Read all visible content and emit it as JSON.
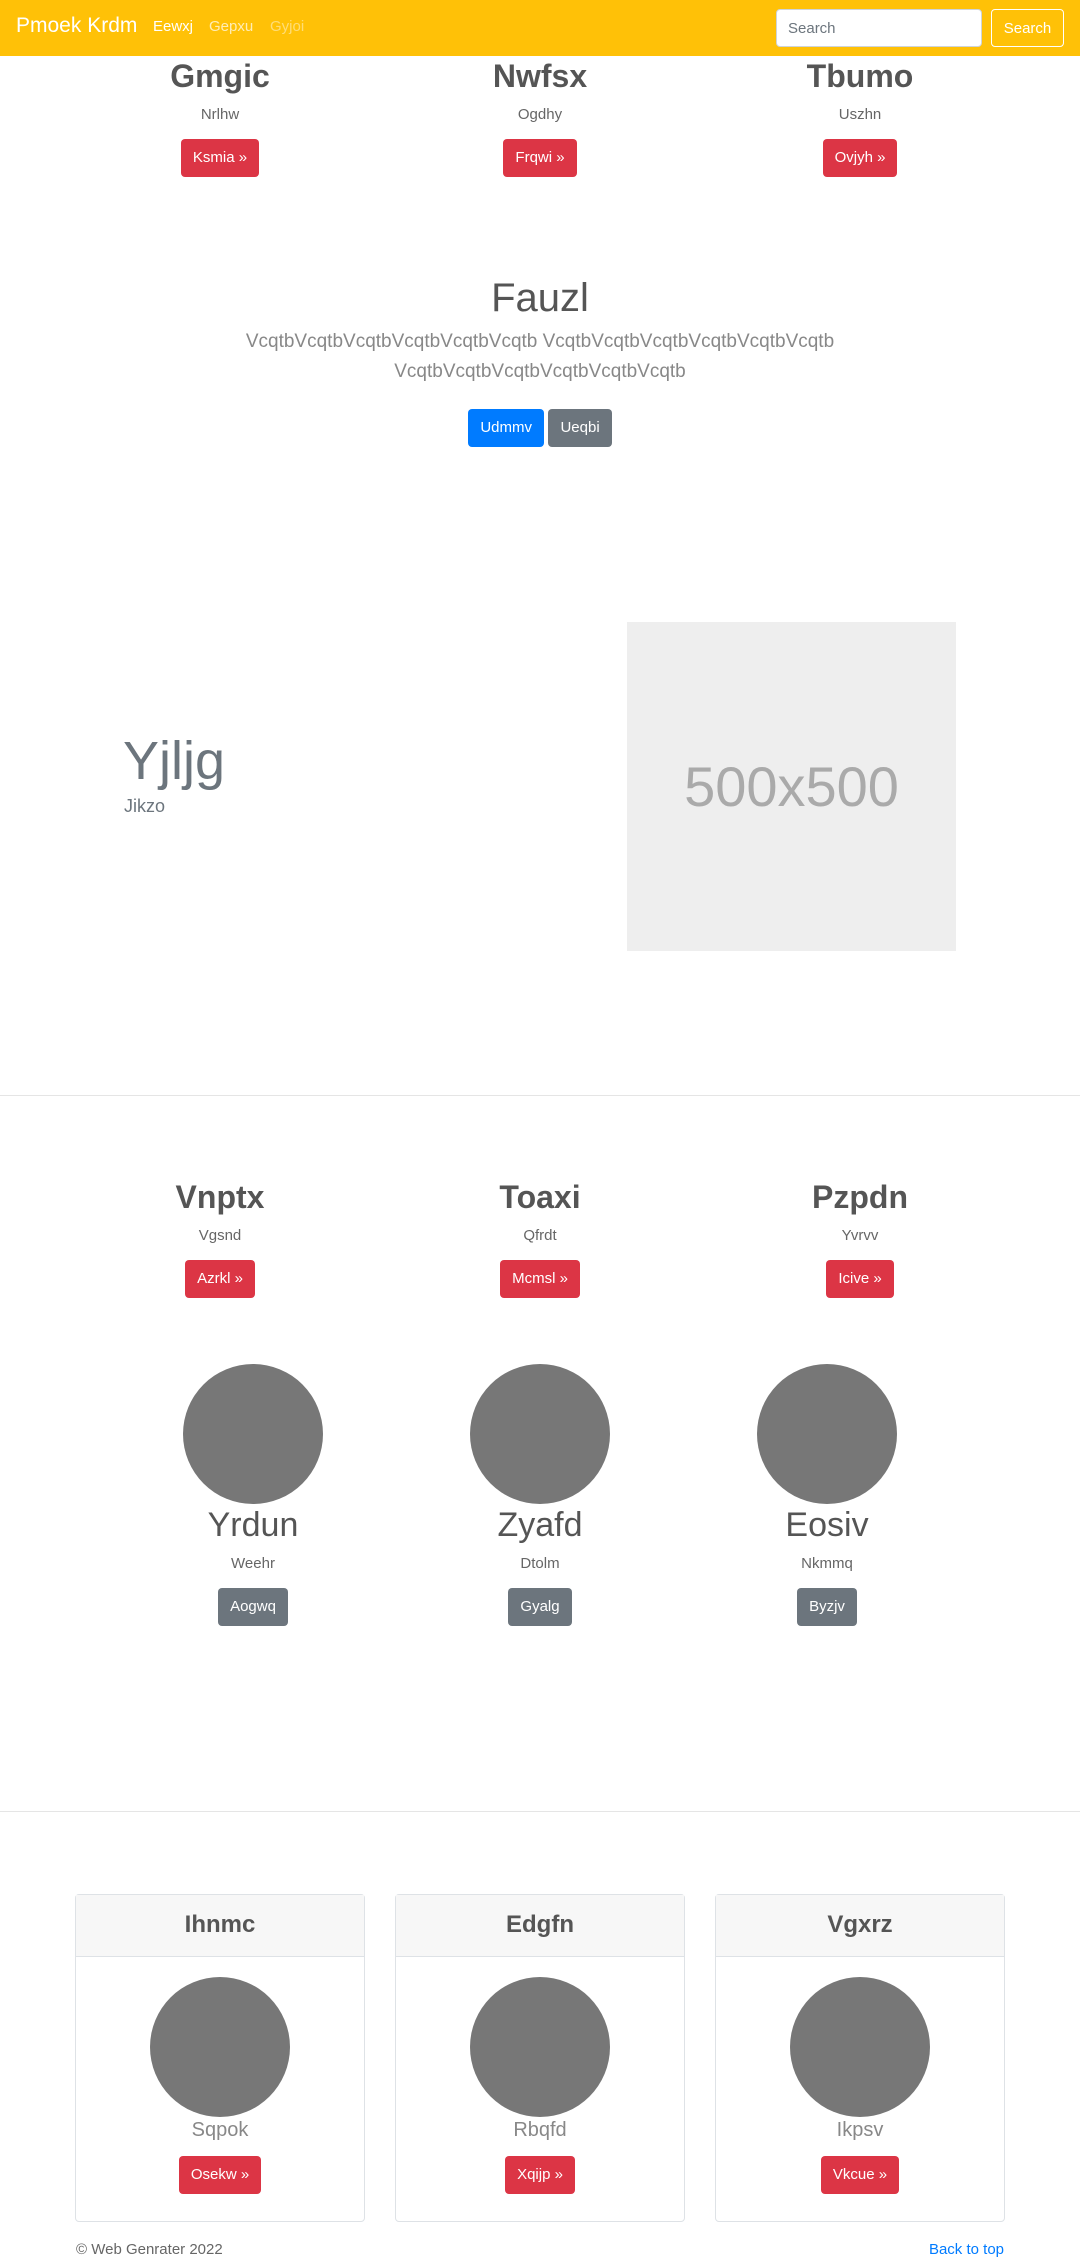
{
  "navbar": {
    "brand": "Pmoek Krdm",
    "links": [
      "Eewxj",
      "Gepxu",
      "Gyjoi"
    ],
    "search_placeholder": "Search",
    "search_button": "Search"
  },
  "top_columns": [
    {
      "title": "Gmgic",
      "sub": "Nrlhw",
      "button": "Ksmia »"
    },
    {
      "title": "Nwfsx",
      "sub": "Ogdhy",
      "button": "Frqwi »"
    },
    {
      "title": "Tbumo",
      "sub": "Uszhn",
      "button": "Ovjyh »"
    }
  ],
  "jumbo": {
    "title": "Fauzl",
    "lead": "VcqtbVcqtbVcqtbVcqtbVcqtbVcqtb VcqtbVcqtbVcqtbVcqtbVcqtbVcqtb VcqtbVcqtbVcqtbVcqtbVcqtbVcqtb",
    "primary_button": "Udmmv",
    "secondary_button": "Ueqbi"
  },
  "feature": {
    "title": "Yjljg",
    "sub": "Jikzo",
    "image_label": "500x500"
  },
  "mid_columns": [
    {
      "title": "Vnptx",
      "sub": "Vgsnd",
      "button": "Azrkl »"
    },
    {
      "title": "Toaxi",
      "sub": "Qfrdt",
      "button": "Mcmsl »"
    },
    {
      "title": "Pzpdn",
      "sub": "Yvrvv",
      "button": "Icive »"
    }
  ],
  "people": [
    {
      "name": "Yrdun",
      "sub": "Weehr",
      "button": "Aogwq"
    },
    {
      "name": "Zyafd",
      "sub": "Dtolm",
      "button": "Gyalg"
    },
    {
      "name": "Eosiv",
      "sub": "Nkmmq",
      "button": "Byzjv"
    }
  ],
  "cards": [
    {
      "header": "Ihnmc",
      "sub": "Sqpok",
      "button": "Osekw »"
    },
    {
      "header": "Edgfn",
      "sub": "Rbqfd",
      "button": "Xqijp »"
    },
    {
      "header": "Vgxrz",
      "sub": "Ikpsv",
      "button": "Vkcue »"
    }
  ],
  "footer": {
    "copyright": "© Web Genrater 2022",
    "back_to_top": "Back to top"
  }
}
